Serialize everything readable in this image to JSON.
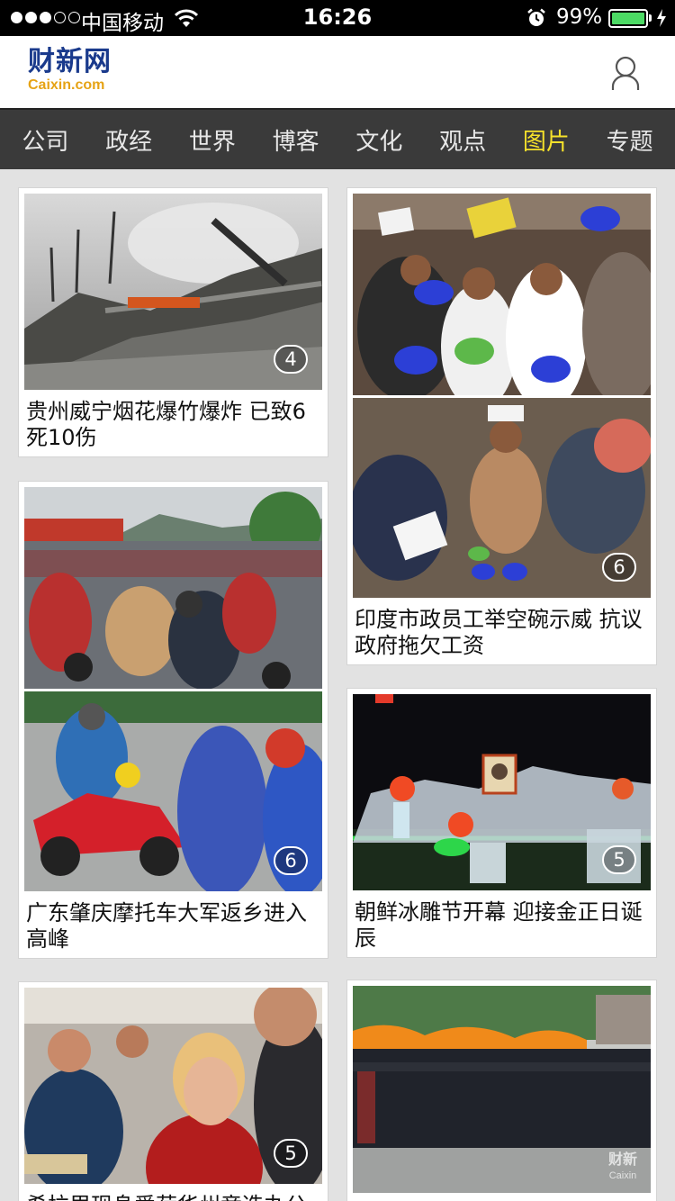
{
  "status_bar": {
    "carrier": "中国移动",
    "time": "16:26",
    "battery_percent": "99%",
    "battery_level": 0.99,
    "signal_bars": 3,
    "signal_total": 5
  },
  "header": {
    "logo_cn": "财新网",
    "logo_en": "Caixin.com",
    "user_icon": "user-icon"
  },
  "nav": {
    "items": [
      "公司",
      "政经",
      "世界",
      "博客",
      "文化",
      "观点",
      "图片",
      "专题"
    ],
    "active": "图片",
    "active_color": "#f5e12b"
  },
  "cards": [
    {
      "title": "贵州威宁烟花爆竹爆炸 已致6死10伤",
      "count": "4"
    },
    {
      "title": "印度市政员工举空碗示威 抗议政府拖欠工资",
      "count": "6"
    },
    {
      "title": "广东肇庆摩托车大军返乡进入高峰",
      "count": "6"
    },
    {
      "title": "朝鲜冰雕节开幕 迎接金正日诞辰",
      "count": "5"
    },
    {
      "title": "希拉里现身爱荷华州竞选办公",
      "count": "5"
    },
    {
      "title": "",
      "count": ""
    }
  ],
  "watermark": {
    "cn": "财新",
    "en": "Caixin"
  },
  "colors": {
    "status_bg": "#000000",
    "nav_bg": "#3a3a3a",
    "logo_blue": "#1a3a8c",
    "logo_gold": "#e6a315",
    "battery_green": "#4cd964",
    "page_bg": "#e2e2e2"
  }
}
